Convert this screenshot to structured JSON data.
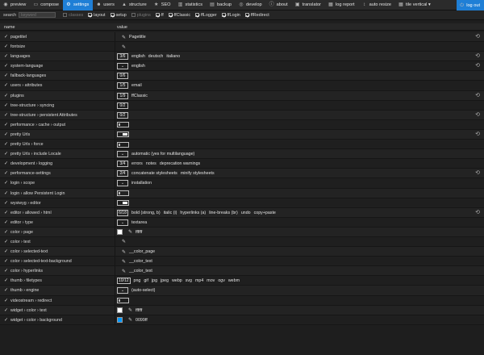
{
  "topbar": {
    "tabs": [
      {
        "id": "preview",
        "label": "preview",
        "icon": "eye-icon",
        "glyph": "◉",
        "active": false
      },
      {
        "id": "compose",
        "label": "compose",
        "icon": "file-icon",
        "glyph": "▭",
        "active": false
      },
      {
        "id": "settings",
        "label": "settings",
        "icon": "gear-icon",
        "glyph": "⚙",
        "active": true
      },
      {
        "id": "users",
        "label": "users",
        "icon": "users-icon",
        "glyph": "☻",
        "active": false
      },
      {
        "id": "structure",
        "label": "structure",
        "icon": "structure-icon",
        "glyph": "▲",
        "active": false
      },
      {
        "id": "seo",
        "label": "SEO",
        "icon": "star-icon",
        "glyph": "★",
        "active": false
      },
      {
        "id": "statistics",
        "label": "statistics",
        "icon": "chart-icon",
        "glyph": "▥",
        "active": false
      },
      {
        "id": "backup",
        "label": "backup",
        "icon": "backup-icon",
        "glyph": "▤",
        "active": false
      },
      {
        "id": "develop",
        "label": "develop",
        "icon": "develop-icon",
        "glyph": "◎",
        "active": false
      },
      {
        "id": "about",
        "label": "about",
        "icon": "info-icon",
        "glyph": "ⓘ",
        "active": false
      },
      {
        "id": "translator",
        "label": "translator",
        "icon": "translate-icon",
        "glyph": "▣",
        "active": false
      },
      {
        "id": "log-report",
        "label": "log report",
        "icon": "log-icon",
        "glyph": "▦",
        "active": false
      },
      {
        "id": "auto-resize",
        "label": "auto resize",
        "icon": "resize-icon",
        "glyph": "↕",
        "active": false
      },
      {
        "id": "tile-vertical",
        "label": "tile vertical ▾",
        "icon": "tile-icon",
        "glyph": "▦",
        "active": false
      }
    ],
    "logout": {
      "label": "log out",
      "icon": "logout-icon",
      "glyph": "⏻"
    }
  },
  "filter": {
    "search_label": "search",
    "search_placeholder": "keyword",
    "toggles": [
      {
        "label": "classes",
        "checked": false
      },
      {
        "label": "layout",
        "checked": true
      },
      {
        "label": "setup",
        "checked": true
      },
      {
        "label": "plugins",
        "checked": false
      },
      {
        "label": "ff",
        "checked": true
      },
      {
        "label": "ffClassic",
        "checked": true
      },
      {
        "label": "ffLogger",
        "checked": true
      },
      {
        "label": "ffLogin",
        "checked": true
      },
      {
        "label": "ffRedirect",
        "checked": true
      }
    ]
  },
  "table": {
    "col_name": "name",
    "col_value": "value",
    "rows": [
      {
        "name": "pagetitel",
        "reset": true,
        "items": [
          {
            "t": "pen"
          },
          {
            "t": "text",
            "v": "Pagetitle"
          }
        ]
      },
      {
        "name": "fontsize",
        "reset": false,
        "items": [
          {
            "t": "pen"
          }
        ]
      },
      {
        "name": "languages",
        "reset": true,
        "items": [
          {
            "t": "box",
            "v": "3/6"
          },
          {
            "t": "text",
            "v": "english"
          },
          {
            "t": "text",
            "v": "deutsch"
          },
          {
            "t": "text",
            "v": "italiano"
          }
        ]
      },
      {
        "name": "system-language",
        "reset": true,
        "items": [
          {
            "t": "sel"
          },
          {
            "t": "text",
            "v": "english"
          }
        ]
      },
      {
        "name": "fallback-languages",
        "reset": false,
        "items": [
          {
            "t": "box",
            "v": "0/6"
          }
        ]
      },
      {
        "name": "users › attributes",
        "reset": false,
        "items": [
          {
            "t": "box",
            "v": "1/5"
          },
          {
            "t": "text",
            "v": "email"
          }
        ]
      },
      {
        "name": "plugins",
        "reset": true,
        "items": [
          {
            "t": "box",
            "v": "1/9"
          },
          {
            "t": "text",
            "v": "ffClassic"
          }
        ]
      },
      {
        "name": "tree-structure › syncing",
        "reset": false,
        "items": [
          {
            "t": "box",
            "v": "0/2"
          }
        ]
      },
      {
        "name": "tree-structure › persistent Attributes",
        "reset": true,
        "items": [
          {
            "t": "box",
            "v": "0/2"
          }
        ]
      },
      {
        "name": "performance › cache › output",
        "reset": false,
        "items": [
          {
            "t": "toggle",
            "on": false
          }
        ]
      },
      {
        "name": "pretty Urls",
        "reset": true,
        "items": [
          {
            "t": "toggle",
            "on": true
          }
        ]
      },
      {
        "name": "pretty Urls › force",
        "reset": false,
        "items": [
          {
            "t": "toggle",
            "on": false
          }
        ]
      },
      {
        "name": "pretty Urls › include Locale",
        "reset": false,
        "items": [
          {
            "t": "sel"
          },
          {
            "t": "text",
            "v": "automatic (yes for multilanguage)"
          }
        ]
      },
      {
        "name": "development › logging",
        "reset": false,
        "items": [
          {
            "t": "box",
            "v": "3/4"
          },
          {
            "t": "text",
            "v": "errors"
          },
          {
            "t": "text",
            "v": "notes"
          },
          {
            "t": "text",
            "v": "deprecation warnings"
          }
        ]
      },
      {
        "name": "performance-settings",
        "reset": true,
        "items": [
          {
            "t": "box",
            "v": "2/4"
          },
          {
            "t": "text",
            "v": "concatenate stylesheets"
          },
          {
            "t": "text",
            "v": "minify stylesheets"
          }
        ]
      },
      {
        "name": "login › scope",
        "reset": false,
        "items": [
          {
            "t": "sel"
          },
          {
            "t": "text",
            "v": "installation"
          }
        ]
      },
      {
        "name": "login › allow Persistent Login",
        "reset": false,
        "items": [
          {
            "t": "toggle",
            "on": false
          }
        ]
      },
      {
        "name": "wysiwyg › editor",
        "reset": false,
        "items": [
          {
            "t": "toggle",
            "on": true
          }
        ]
      },
      {
        "name": "editor › allowed › html",
        "reset": true,
        "items": [
          {
            "t": "box",
            "v": "6/18"
          },
          {
            "t": "text",
            "v": "bold (strong, b)"
          },
          {
            "t": "text",
            "v": "italic (i)"
          },
          {
            "t": "text",
            "v": "hyperlinks (a)"
          },
          {
            "t": "text",
            "v": "line-breaks (br)"
          },
          {
            "t": "text",
            "v": "undo"
          },
          {
            "t": "text",
            "v": "copy+paste"
          }
        ]
      },
      {
        "name": "editor › type",
        "reset": false,
        "items": [
          {
            "t": "sel"
          },
          {
            "t": "text",
            "v": "textarea"
          }
        ]
      },
      {
        "name": "color › page",
        "reset": false,
        "items": [
          {
            "t": "swatch",
            "c": "#ffffff"
          },
          {
            "t": "pen"
          },
          {
            "t": "text",
            "v": "ffffff"
          }
        ]
      },
      {
        "name": "color › text",
        "reset": false,
        "items": [
          {
            "t": "pen"
          }
        ]
      },
      {
        "name": "color › selected-text",
        "reset": false,
        "items": [
          {
            "t": "pen"
          },
          {
            "t": "text",
            "v": "__color_page"
          }
        ]
      },
      {
        "name": "color › selected-text-background",
        "reset": false,
        "items": [
          {
            "t": "pen"
          },
          {
            "t": "text",
            "v": "__color_text"
          }
        ]
      },
      {
        "name": "color › hyperlinks",
        "reset": false,
        "items": [
          {
            "t": "pen"
          },
          {
            "t": "text",
            "v": "__color_text"
          }
        ]
      },
      {
        "name": "thumb › filetypes",
        "reset": false,
        "items": [
          {
            "t": "box",
            "v": "10/12"
          },
          {
            "t": "text",
            "v": "png"
          },
          {
            "t": "text",
            "v": "gif"
          },
          {
            "t": "text",
            "v": "jpg"
          },
          {
            "t": "text",
            "v": "jpeg"
          },
          {
            "t": "text",
            "v": "webp"
          },
          {
            "t": "text",
            "v": "svg"
          },
          {
            "t": "text",
            "v": "mp4"
          },
          {
            "t": "text",
            "v": "mov"
          },
          {
            "t": "text",
            "v": "ogv"
          },
          {
            "t": "text",
            "v": "webm"
          }
        ]
      },
      {
        "name": "thumb › engine",
        "reset": false,
        "items": [
          {
            "t": "sel"
          },
          {
            "t": "text",
            "v": "(auto-select)"
          }
        ]
      },
      {
        "name": "videostream › redirect",
        "reset": false,
        "items": [
          {
            "t": "toggle",
            "on": false
          }
        ]
      },
      {
        "name": "widget › color › text",
        "reset": false,
        "items": [
          {
            "t": "swatch",
            "c": "#ffffff"
          },
          {
            "t": "pen"
          },
          {
            "t": "text",
            "v": "ffffff"
          }
        ]
      },
      {
        "name": "widget › color › background",
        "reset": false,
        "items": [
          {
            "t": "swatch",
            "c": "#0099ff"
          },
          {
            "t": "pen"
          },
          {
            "t": "text",
            "v": "0099ff"
          }
        ]
      }
    ]
  },
  "icons": {
    "row_check": "check-icon",
    "row_check_glyph": "✓",
    "reset": "reset-icon",
    "reset_glyph": "⟲",
    "pen": "pencil-icon",
    "pen_glyph": "✎",
    "select": "chevron-down-icon",
    "select_glyph": "⌄"
  },
  "colors": {
    "accent": "#1f7fd6",
    "background": "#1e1e1e"
  }
}
